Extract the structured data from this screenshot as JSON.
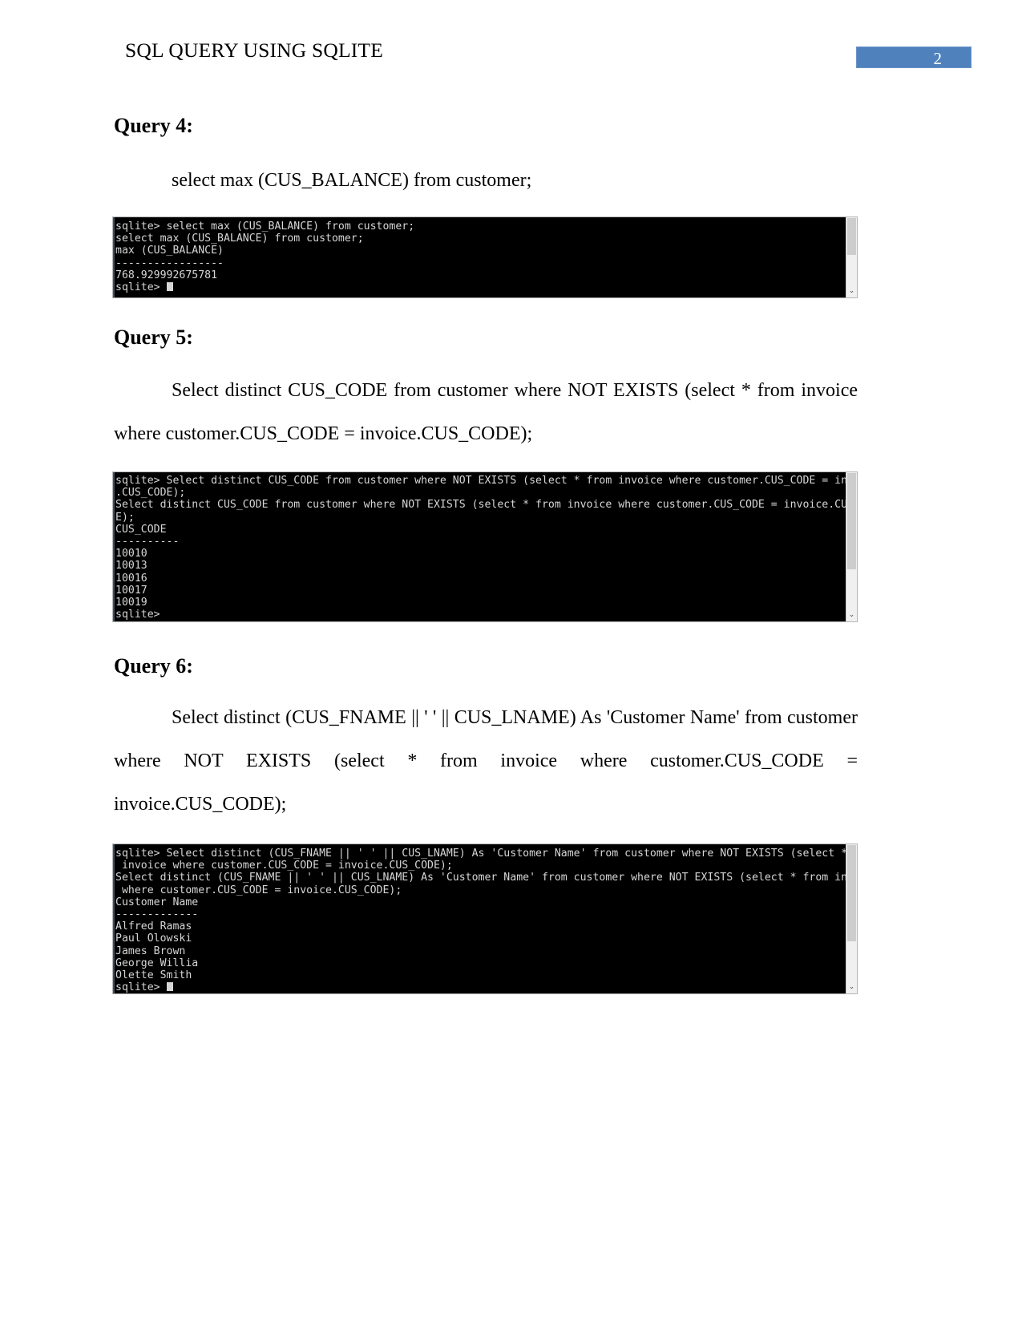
{
  "header": {
    "title": "SQL QUERY USING SQLITE",
    "page_number": "2",
    "badge_color": "#4F81BD"
  },
  "sections": [
    {
      "heading": "Query 4:",
      "body": "select max (CUS_BALANCE) from customer;",
      "terminal": {
        "lines": [
          "sqlite> select max (CUS_BALANCE) from customer;",
          "select max (CUS_BALANCE) from customer;",
          "max (CUS_BALANCE)",
          "-----------------",
          "768.929992675781",
          "sqlite> "
        ],
        "cursor_on_last_line": true,
        "scroll_down_arrow": "⌄"
      }
    },
    {
      "heading": "Query 5:",
      "body": "Select distinct CUS_CODE from customer where NOT EXISTS (select * from invoice where customer.CUS_CODE = invoice.CUS_CODE);",
      "terminal": {
        "lines": [
          "sqlite> Select distinct CUS_CODE from customer where NOT EXISTS (select * from invoice where customer.CUS_CODE = invoice",
          ".CUS_CODE);",
          "Select distinct CUS_CODE from customer where NOT EXISTS (select * from invoice where customer.CUS_CODE = invoice.CUS_COD",
          "E);",
          "CUS_CODE",
          "----------",
          "10010",
          "10013",
          "10016",
          "10017",
          "10019",
          "sqlite>"
        ],
        "cursor_on_last_line": false,
        "scroll_down_arrow": "⌄"
      }
    },
    {
      "heading": "Query 6:",
      "body": "Select distinct (CUS_FNAME || ' ' || CUS_LNAME) As 'Customer Name' from customer where NOT EXISTS (select * from invoice where customer.CUS_CODE = invoice.CUS_CODE);",
      "terminal": {
        "lines": [
          "sqlite> Select distinct (CUS_FNAME || ' ' || CUS_LNAME) As 'Customer Name' from customer where NOT EXISTS (select * from",
          " invoice where customer.CUS_CODE = invoice.CUS_CODE);",
          "Select distinct (CUS_FNAME || ' ' || CUS_LNAME) As 'Customer Name' from customer where NOT EXISTS (select * from invoice",
          " where customer.CUS_CODE = invoice.CUS_CODE);",
          "Customer Name",
          "-------------",
          "Alfred Ramas",
          "Paul Olowski",
          "James Brown",
          "George Willia",
          "Olette Smith",
          "sqlite> "
        ],
        "cursor_on_last_line": true,
        "scroll_down_arrow": "⌄"
      }
    }
  ]
}
